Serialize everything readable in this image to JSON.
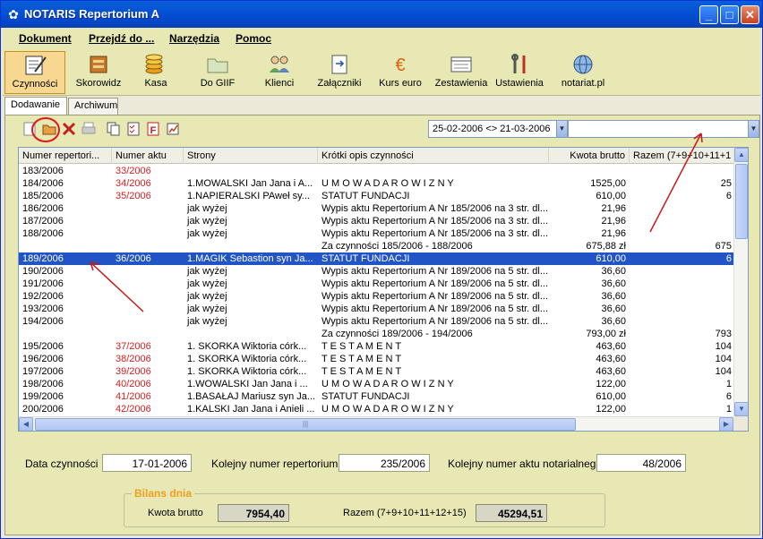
{
  "window": {
    "title": "NOTARIS Repertorium A"
  },
  "menu": [
    {
      "label": "Dokument"
    },
    {
      "label": "Przejdź do ..."
    },
    {
      "label": "Narzędzia"
    },
    {
      "label": "Pomoc"
    }
  ],
  "toolbar": [
    {
      "label": "Czynności",
      "icon": "notebook-pen-icon",
      "active": true
    },
    {
      "label": "Skorowidz",
      "icon": "box-icon"
    },
    {
      "label": "Kasa",
      "icon": "coins-icon"
    },
    {
      "label": "Do GIIF",
      "icon": "folder-icon"
    },
    {
      "label": "Klienci",
      "icon": "people-icon"
    },
    {
      "label": "Załączniki",
      "icon": "attachment-icon"
    },
    {
      "label": "Kurs euro",
      "icon": "euro-icon"
    },
    {
      "label": "Zestawienia",
      "icon": "report-icon"
    },
    {
      "label": "Ustawienia",
      "icon": "tools-icon"
    },
    {
      "label": "notariat.pl",
      "icon": "globe-icon"
    }
  ],
  "tabs": [
    {
      "label": "Dodawanie",
      "selected": true
    },
    {
      "label": "Archiwum",
      "selected": false
    }
  ],
  "filter": {
    "date_range": "25-02-2006 <> 21-03-2006",
    "second": ""
  },
  "columns": [
    "Numer repertori...",
    "Numer aktu",
    "Strony",
    "Krótki opis czynności",
    "Kwota brutto",
    "Razem (7+9+10+11+1"
  ],
  "rows": [
    {
      "nr": "183/2006",
      "akt": "33/2006",
      "strony": "",
      "opis": "",
      "kwota": "",
      "razem": ""
    },
    {
      "nr": "184/2006",
      "akt": "34/2006",
      "strony": "1.MOWALSKI Jan Jana i A...",
      "opis": "U M O W A  D A R O W I Z N Y",
      "kwota": "1525,00",
      "razem": "25"
    },
    {
      "nr": "185/2006",
      "akt": "35/2006",
      "strony": "1.NAPIERALSKI PAweł sy...",
      "opis": "STATUT    FUNDACJI",
      "kwota": "610,00",
      "razem": "6"
    },
    {
      "nr": "186/2006",
      "akt": "",
      "strony": "jak wyżej",
      "opis": "Wypis aktu Repertorium A Nr 185/2006 na 3 str. dl...",
      "kwota": "21,96",
      "razem": ""
    },
    {
      "nr": "187/2006",
      "akt": "",
      "strony": "jak wyżej",
      "opis": "Wypis aktu Repertorium A Nr 185/2006 na 3 str. dl...",
      "kwota": "21,96",
      "razem": ""
    },
    {
      "nr": "188/2006",
      "akt": "",
      "strony": "jak wyżej",
      "opis": "Wypis aktu Repertorium A Nr 185/2006 na 3 str. dl...",
      "kwota": "21,96",
      "razem": ""
    },
    {
      "nr": "",
      "akt": "",
      "strony": "",
      "opis": "Za czynności 185/2006 - 188/2006",
      "kwota": "675,88 zł",
      "razem": "675"
    },
    {
      "nr": "189/2006",
      "akt": "36/2006",
      "strony": "1.MAGIK Sebastion syn Ja...",
      "opis": "STATUT    FUNDACJI",
      "kwota": "610,00",
      "razem": "6",
      "selected": true
    },
    {
      "nr": "190/2006",
      "akt": "",
      "strony": "jak wyżej",
      "opis": "Wypis aktu Repertorium A Nr 189/2006 na 5 str. dl...",
      "kwota": "36,60",
      "razem": ""
    },
    {
      "nr": "191/2006",
      "akt": "",
      "strony": "jak wyżej",
      "opis": "Wypis aktu Repertorium A Nr 189/2006 na 5 str. dl...",
      "kwota": "36,60",
      "razem": ""
    },
    {
      "nr": "192/2006",
      "akt": "",
      "strony": "jak wyżej",
      "opis": "Wypis aktu Repertorium A Nr 189/2006 na 5 str. dl...",
      "kwota": "36,60",
      "razem": ""
    },
    {
      "nr": "193/2006",
      "akt": "",
      "strony": "jak wyżej",
      "opis": "Wypis aktu Repertorium A Nr 189/2006 na 5 str. dl...",
      "kwota": "36,60",
      "razem": ""
    },
    {
      "nr": "194/2006",
      "akt": "",
      "strony": "jak wyżej",
      "opis": "Wypis aktu Repertorium A Nr 189/2006 na 5 str. dl...",
      "kwota": "36,60",
      "razem": ""
    },
    {
      "nr": "",
      "akt": "",
      "strony": "",
      "opis": "Za czynności 189/2006 - 194/2006",
      "kwota": "793,00 zł",
      "razem": "793"
    },
    {
      "nr": "195/2006",
      "akt": "37/2006",
      "strony": "1. SKORKA  Wiktoria córk...",
      "opis": "T E S T A M E N T",
      "kwota": "463,60",
      "razem": "104"
    },
    {
      "nr": "196/2006",
      "akt": "38/2006",
      "strony": "1. SKORKA  Wiktoria córk...",
      "opis": "T E S T A M E N T",
      "kwota": "463,60",
      "razem": "104"
    },
    {
      "nr": "197/2006",
      "akt": "39/2006",
      "strony": "1. SKORKA  Wiktoria córk...",
      "opis": "T E S T A M E N T",
      "kwota": "463,60",
      "razem": "104"
    },
    {
      "nr": "198/2006",
      "akt": "40/2006",
      "strony": "1.WOWALSKI Jan Jana i ...",
      "opis": "U M O W A  D A R O W I Z N Y",
      "kwota": "122,00",
      "razem": "1"
    },
    {
      "nr": "199/2006",
      "akt": "41/2006",
      "strony": "1.BASAŁAJ Mariusz syn Ja...",
      "opis": "STATUT    FUNDACJI",
      "kwota": "610,00",
      "razem": "6"
    },
    {
      "nr": "200/2006",
      "akt": "42/2006",
      "strony": "1.KALSKI Jan Jana i Anieli ...",
      "opis": "U M O W A  D A R O W I Z N Y",
      "kwota": "122,00",
      "razem": "1"
    }
  ],
  "fields": {
    "data_label": "Data czynności",
    "data_value": "17-01-2006",
    "rep_label": "Kolejny numer repertorium",
    "rep_value": "235/2006",
    "akt_label": "Kolejny numer aktu notarialnego",
    "akt_value": "48/2006"
  },
  "bilans": {
    "title": "Bilans dnia",
    "kwota_label": "Kwota brutto",
    "kwota_value": "7954,40",
    "razem_label": "Razem (7+9+10+11+12+15)",
    "razem_value": "45294,51"
  },
  "colors": {
    "title_blue": "#0350d4",
    "toolbar_bg": "#e7e8b4",
    "selection": "#2154c4",
    "akt_red": "#d42020",
    "annotation_red": "#e01818"
  }
}
